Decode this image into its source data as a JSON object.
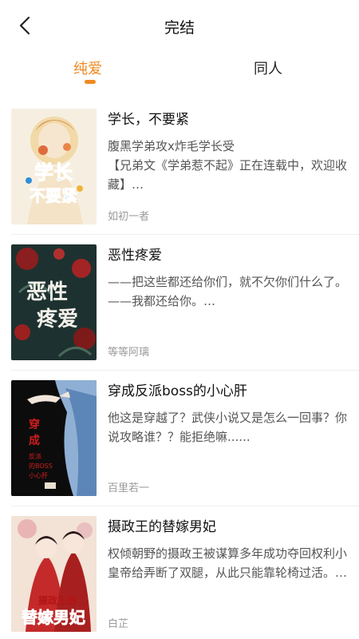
{
  "header": {
    "title": "完结",
    "back_icon": "chevron-left-icon"
  },
  "tabs": [
    {
      "label": "纯爱",
      "active": true
    },
    {
      "label": "同人",
      "active": false
    }
  ],
  "colors": {
    "accent": "#f08a23",
    "text": "#222222",
    "muted": "#9a9a9a"
  },
  "books": [
    {
      "title": "学长，不要紧",
      "description": "腹黑学弟攻x炸毛学长受\n【兄弟文《学弟惹不起》正在连载中，欢迎收藏】…",
      "author": "如初一者",
      "cover_text": "学长，不要紧"
    },
    {
      "title": "恶性疼爱",
      "description": "——把这些都还给你们，就不欠你们什么了。\n——我都还给你。…",
      "author": "等等阿璃",
      "cover_text": "恶性疼爱"
    },
    {
      "title": "穿成反派boss的小心肝",
      "description": "他这是穿越了？武侠小说又是怎么一回事？你说攻略谁？？能拒绝嘛......",
      "author": "百里若一",
      "cover_text": "穿成反派的BOSS的小心肝"
    },
    {
      "title": "摄政王的替嫁男妃",
      "description": "权倾朝野的摄政王被谋算多年成功夺回权利小皇帝给弄断了双腿，从此只能靠轮椅过活。…",
      "author": "白芷",
      "cover_text": "摄政王的替嫁男妃"
    }
  ]
}
